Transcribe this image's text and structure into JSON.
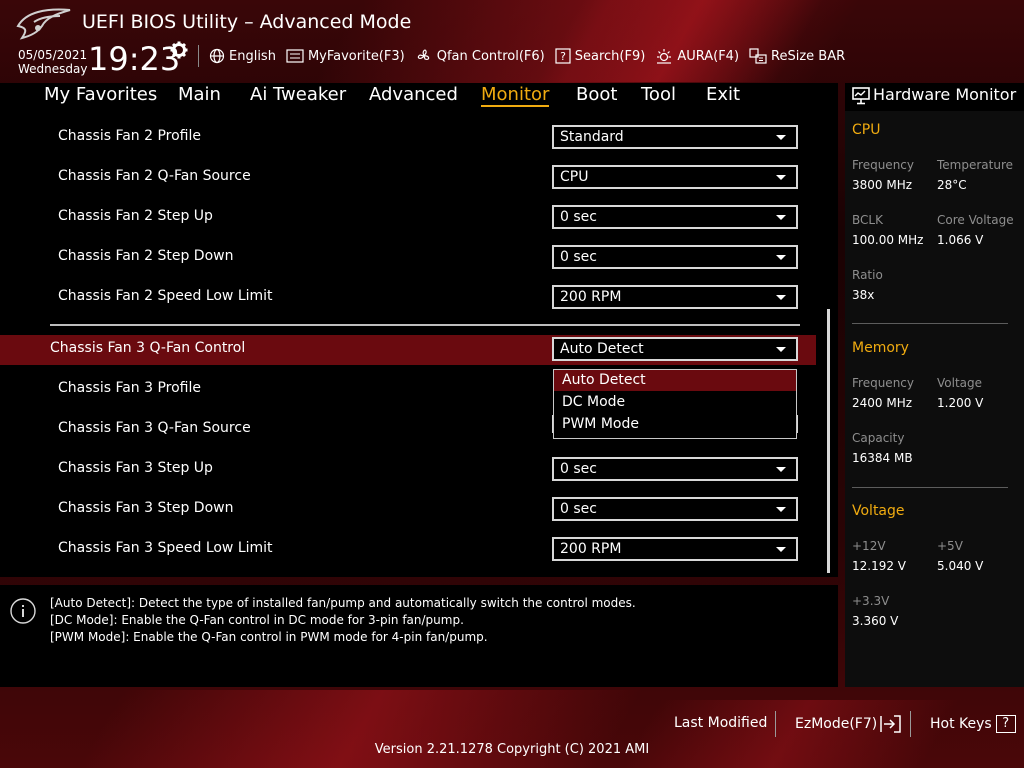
{
  "header": {
    "title": "UEFI BIOS Utility – Advanced Mode",
    "date": "05/05/2021",
    "weekday": "Wednesday",
    "time": "19:23",
    "toolbar": [
      {
        "label": "English",
        "icon": "globe-icon"
      },
      {
        "label": "MyFavorite(F3)",
        "icon": "favorite-icon"
      },
      {
        "label": "Qfan Control(F6)",
        "icon": "fan-icon"
      },
      {
        "label": "Search(F9)",
        "icon": "search-icon"
      },
      {
        "label": "AURA(F4)",
        "icon": "aura-icon"
      },
      {
        "label": "ReSize BAR",
        "icon": "resize-bar-icon"
      }
    ]
  },
  "menu": {
    "tabs": [
      "My Favorites",
      "Main",
      "Ai Tweaker",
      "Advanced",
      "Monitor",
      "Boot",
      "Tool",
      "Exit"
    ],
    "active": "Monitor"
  },
  "settings": [
    {
      "label": "Chassis Fan 2 Profile",
      "value": "Standard"
    },
    {
      "label": "Chassis Fan 2 Q-Fan Source",
      "value": "CPU"
    },
    {
      "label": "Chassis Fan 2 Step Up",
      "value": "0 sec"
    },
    {
      "label": "Chassis Fan 2 Step Down",
      "value": "0 sec"
    },
    {
      "label": "Chassis Fan 2 Speed Low Limit",
      "value": "200 RPM"
    },
    {
      "label": "Chassis Fan 3 Q-Fan Control",
      "value": "Auto Detect"
    },
    {
      "label": "Chassis Fan 3 Profile",
      "value": ""
    },
    {
      "label": "Chassis Fan 3 Q-Fan Source",
      "value": ""
    },
    {
      "label": "Chassis Fan 3 Step Up",
      "value": "0 sec"
    },
    {
      "label": "Chassis Fan 3 Step Down",
      "value": "0 sec"
    },
    {
      "label": "Chassis Fan 3 Speed Low Limit",
      "value": "200 RPM"
    }
  ],
  "dropdown": {
    "options": [
      "Auto Detect",
      "DC Mode",
      "PWM Mode"
    ],
    "selected": "Auto Detect"
  },
  "help": {
    "lines": [
      "[Auto Detect]: Detect the type of installed fan/pump and automatically switch the control modes.",
      "[DC Mode]: Enable the Q-Fan control in DC mode for 3-pin fan/pump.",
      "[PWM Mode]: Enable the Q-Fan control in PWM mode for 4-pin fan/pump."
    ]
  },
  "hw_monitor": {
    "title": "Hardware Monitor",
    "cpu": {
      "title": "CPU",
      "frequency_label": "Frequency",
      "frequency": "3800 MHz",
      "temperature_label": "Temperature",
      "temperature": "28°C",
      "bclk_label": "BCLK",
      "bclk": "100.00 MHz",
      "core_voltage_label": "Core Voltage",
      "core_voltage": "1.066 V",
      "ratio_label": "Ratio",
      "ratio": "38x"
    },
    "memory": {
      "title": "Memory",
      "frequency_label": "Frequency",
      "frequency": "2400 MHz",
      "voltage_label": "Voltage",
      "voltage": "1.200 V",
      "capacity_label": "Capacity",
      "capacity": "16384 MB"
    },
    "voltage": {
      "title": "Voltage",
      "v12_label": "+12V",
      "v12": "12.192 V",
      "v5_label": "+5V",
      "v5": "5.040 V",
      "v33_label": "+3.3V",
      "v33": "3.360 V"
    }
  },
  "footer": {
    "last_modified": "Last Modified",
    "ezmode": "EzMode(F7)",
    "hotkeys": "Hot Keys",
    "hotkeys_glyph": "?",
    "version": "Version 2.21.1278 Copyright (C) 2021 AMI"
  },
  "colors": {
    "accent": "#f0ab10",
    "highlight": "#6a0a0f",
    "panel_bg": "#000000"
  }
}
